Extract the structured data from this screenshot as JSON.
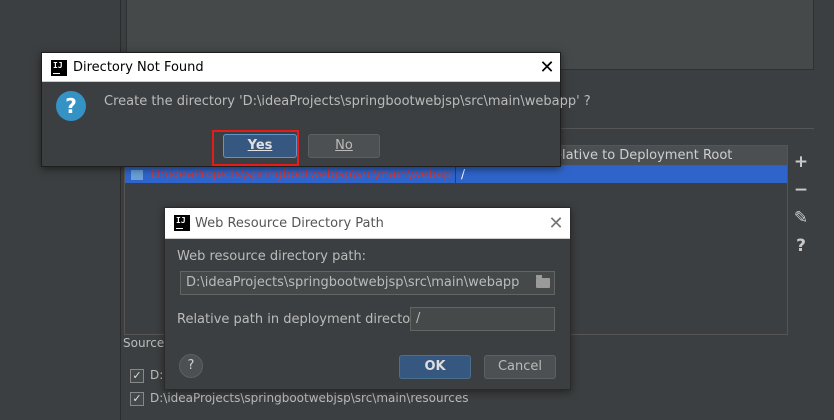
{
  "background": {
    "table_header_right": "elative to Deployment Root",
    "row_path": "D:\\ideaProjects\\springbootwebjsp\\src\\main\\webapp",
    "row_relative": "/",
    "side_tools": [
      "+",
      "−",
      "✎",
      "?"
    ],
    "source_label": "Source R",
    "source_items": [
      {
        "label": "D:",
        "checked": true
      },
      {
        "label": "D:\\ideaProjects\\springbootwebjsp\\src\\main\\resources",
        "checked": true
      }
    ]
  },
  "directory_not_found_dialog": {
    "title": "Directory Not Found",
    "message": "Create the directory 'D:\\ideaProjects\\springbootwebjsp\\src\\main\\webapp' ?",
    "yes_label": "Yes",
    "no_label": "No",
    "icon": "question-icon"
  },
  "web_resource_dialog": {
    "title": "Web Resource Directory Path",
    "dir_label": "Web resource directory path:",
    "dir_value": "D:\\ideaProjects\\springbootwebjsp\\src\\main\\webapp",
    "rel_label": "Relative path in deployment directory:",
    "rel_value": "/",
    "help_label": "?",
    "ok_label": "OK",
    "cancel_label": "Cancel"
  },
  "colors": {
    "accent_button": "#365880",
    "highlight": "#e31c1c",
    "selection": "#2f65ca"
  }
}
